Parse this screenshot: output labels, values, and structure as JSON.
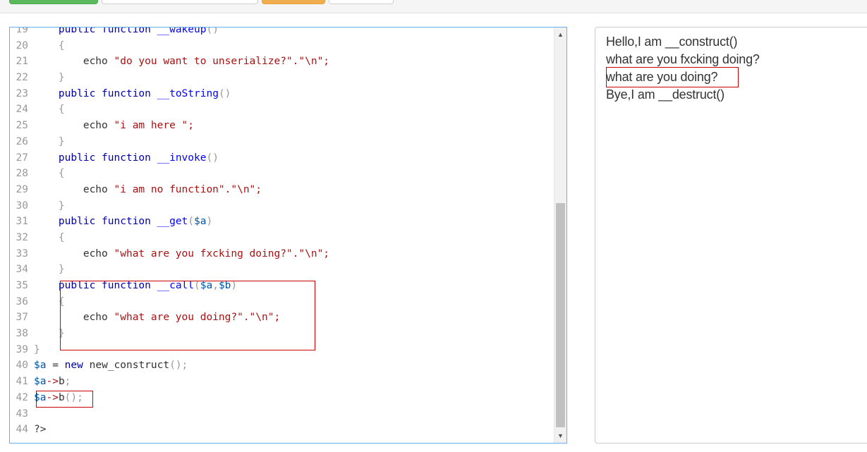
{
  "toolbar": {
    "buttons": [
      "green-button",
      "input-box",
      "orange-button",
      "button"
    ]
  },
  "editor": {
    "lines": [
      {
        "n": "19",
        "tokens": [
          [
            "    ",
            "plain"
          ],
          [
            "public",
            "kw"
          ],
          [
            " ",
            "plain"
          ],
          [
            "function",
            "kw"
          ],
          [
            " ",
            "plain"
          ],
          [
            "__wakeup",
            "fn"
          ],
          [
            "()",
            "punc"
          ]
        ]
      },
      {
        "n": "20",
        "tokens": [
          [
            "    ",
            "plain"
          ],
          [
            "{",
            "punc"
          ]
        ]
      },
      {
        "n": "21",
        "tokens": [
          [
            "        ",
            "plain"
          ],
          [
            "echo",
            "plain"
          ],
          [
            " ",
            "plain"
          ],
          [
            "\"do you want to unserialize?\".\"\\n\";",
            "str"
          ]
        ]
      },
      {
        "n": "22",
        "tokens": [
          [
            "    ",
            "plain"
          ],
          [
            "}",
            "punc"
          ]
        ]
      },
      {
        "n": "23",
        "tokens": [
          [
            "    ",
            "plain"
          ],
          [
            "public",
            "kw"
          ],
          [
            " ",
            "plain"
          ],
          [
            "function",
            "kw"
          ],
          [
            " ",
            "plain"
          ],
          [
            "__toString",
            "fn"
          ],
          [
            "()",
            "punc"
          ]
        ]
      },
      {
        "n": "24",
        "tokens": [
          [
            "    ",
            "plain"
          ],
          [
            "{",
            "punc"
          ]
        ]
      },
      {
        "n": "25",
        "tokens": [
          [
            "        ",
            "plain"
          ],
          [
            "echo",
            "plain"
          ],
          [
            " ",
            "plain"
          ],
          [
            "\"i am here \";",
            "str"
          ]
        ]
      },
      {
        "n": "26",
        "tokens": [
          [
            "    ",
            "plain"
          ],
          [
            "}",
            "punc"
          ]
        ]
      },
      {
        "n": "27",
        "tokens": [
          [
            "    ",
            "plain"
          ],
          [
            "public",
            "kw"
          ],
          [
            " ",
            "plain"
          ],
          [
            "function",
            "kw"
          ],
          [
            " ",
            "plain"
          ],
          [
            "__invoke",
            "fn"
          ],
          [
            "()",
            "punc"
          ]
        ]
      },
      {
        "n": "28",
        "tokens": [
          [
            "    ",
            "plain"
          ],
          [
            "{",
            "punc"
          ]
        ]
      },
      {
        "n": "29",
        "tokens": [
          [
            "        ",
            "plain"
          ],
          [
            "echo",
            "plain"
          ],
          [
            " ",
            "plain"
          ],
          [
            "\"i am no function\".\"\\n\";",
            "str"
          ]
        ]
      },
      {
        "n": "30",
        "tokens": [
          [
            "    ",
            "plain"
          ],
          [
            "}",
            "punc"
          ]
        ]
      },
      {
        "n": "31",
        "tokens": [
          [
            "    ",
            "plain"
          ],
          [
            "public",
            "kw"
          ],
          [
            " ",
            "plain"
          ],
          [
            "function",
            "kw"
          ],
          [
            " ",
            "plain"
          ],
          [
            "__get",
            "fn"
          ],
          [
            "(",
            "punc"
          ],
          [
            "$a",
            "var"
          ],
          [
            ")",
            "punc"
          ]
        ]
      },
      {
        "n": "32",
        "tokens": [
          [
            "    ",
            "plain"
          ],
          [
            "{",
            "punc"
          ]
        ]
      },
      {
        "n": "33",
        "tokens": [
          [
            "        ",
            "plain"
          ],
          [
            "echo",
            "plain"
          ],
          [
            " ",
            "plain"
          ],
          [
            "\"what are you fxcking doing?\".\"\\n\";",
            "str"
          ]
        ]
      },
      {
        "n": "34",
        "tokens": [
          [
            "    ",
            "plain"
          ],
          [
            "}",
            "punc"
          ]
        ]
      },
      {
        "n": "35",
        "tokens": [
          [
            "    ",
            "plain"
          ],
          [
            "public",
            "kw"
          ],
          [
            " ",
            "plain"
          ],
          [
            "function",
            "kw"
          ],
          [
            " ",
            "plain"
          ],
          [
            "__call",
            "fn"
          ],
          [
            "(",
            "punc"
          ],
          [
            "$a",
            "var"
          ],
          [
            ",",
            "punc"
          ],
          [
            "$b",
            "var"
          ],
          [
            ")",
            "punc"
          ]
        ]
      },
      {
        "n": "36",
        "tokens": [
          [
            "    ",
            "plain"
          ],
          [
            "{",
            "punc"
          ]
        ]
      },
      {
        "n": "37",
        "tokens": [
          [
            "        ",
            "plain"
          ],
          [
            "echo",
            "plain"
          ],
          [
            " ",
            "plain"
          ],
          [
            "\"what are you doing?\".\"\\n\";",
            "str"
          ]
        ]
      },
      {
        "n": "38",
        "tokens": [
          [
            "    ",
            "plain"
          ],
          [
            "}",
            "punc"
          ]
        ]
      },
      {
        "n": "39",
        "tokens": [
          [
            "}",
            "punc"
          ]
        ]
      },
      {
        "n": "40",
        "tokens": [
          [
            "$a",
            "var"
          ],
          [
            " = ",
            "plain"
          ],
          [
            "new",
            "kw"
          ],
          [
            " new_construct",
            "plain"
          ],
          [
            "();",
            "punc"
          ]
        ]
      },
      {
        "n": "41",
        "tokens": [
          [
            "$a",
            "var"
          ],
          [
            "->",
            "str"
          ],
          [
            "b",
            "plain"
          ],
          [
            ";",
            "punc"
          ]
        ]
      },
      {
        "n": "42",
        "tokens": [
          [
            "$a",
            "var"
          ],
          [
            "->",
            "str"
          ],
          [
            "b",
            "plain"
          ],
          [
            "();",
            "punc"
          ]
        ]
      },
      {
        "n": "43",
        "tokens": []
      },
      {
        "n": "44",
        "tokens": [
          [
            "?>",
            "plain"
          ]
        ]
      }
    ]
  },
  "output": {
    "lines": [
      "Hello,I am __construct()",
      "what are you fxcking doing?",
      "what are you doing?",
      "Bye,I am __destruct()"
    ]
  },
  "scroll": {
    "up_icon": "▲",
    "down_icon": "▼"
  }
}
